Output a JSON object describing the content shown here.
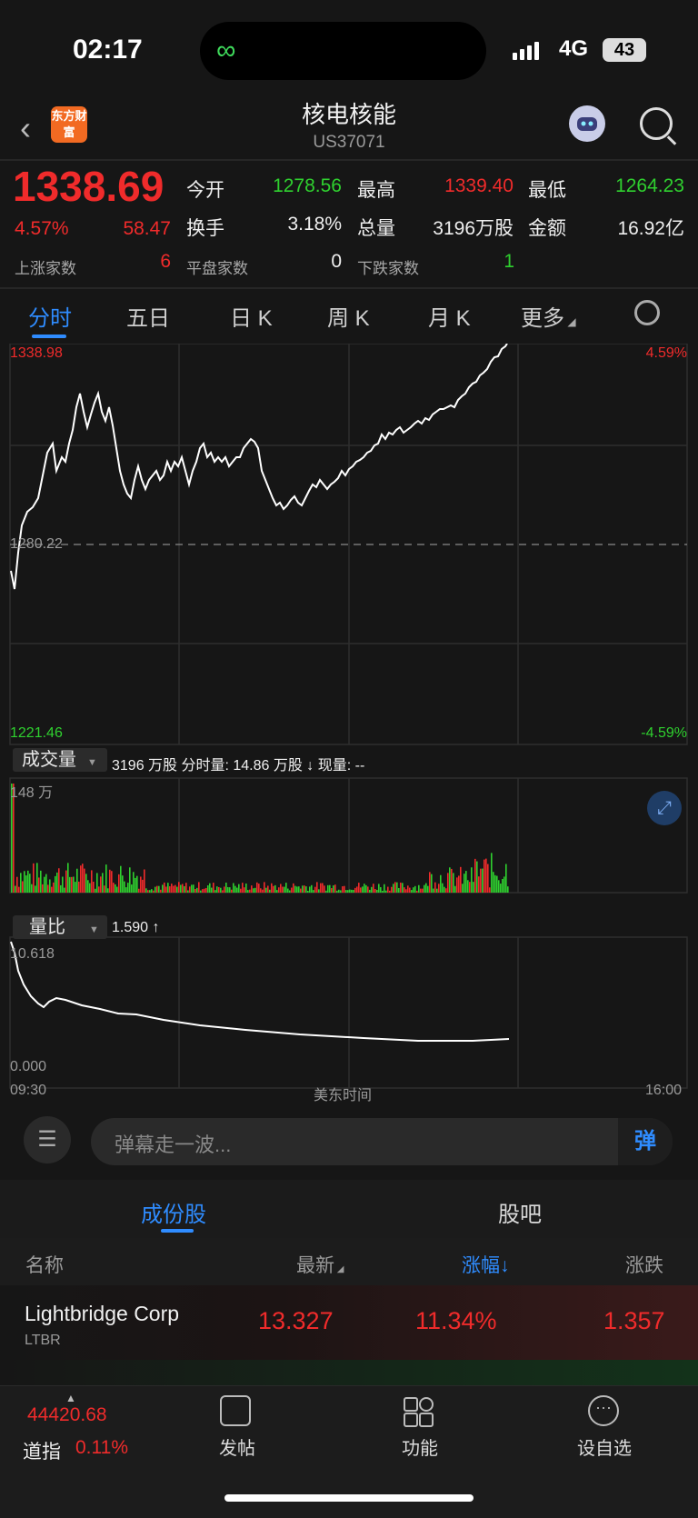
{
  "status_bar": {
    "time": "02:17",
    "network": "4G",
    "battery": "43"
  },
  "header": {
    "logo_text": "东方财富",
    "title": "核电核能",
    "code": "US37071"
  },
  "quote": {
    "price": "1338.69",
    "change_pct": "4.57%",
    "change": "58.47",
    "open_label": "今开",
    "open": "1278.56",
    "high_label": "最高",
    "high": "1339.40",
    "low_label": "最低",
    "low": "1264.23",
    "turnover_label": "换手",
    "turnover": "3.18%",
    "volume_label": "总量",
    "volume": "3196万股",
    "amount_label": "金额",
    "amount": "16.92亿",
    "up_label": "上涨家数",
    "up": "6",
    "flat_label": "平盘家数",
    "flat": "0",
    "down_label": "下跌家数",
    "down": "1"
  },
  "tabs": [
    "分时",
    "五日",
    "日 K",
    "周 K",
    "月 K",
    "更多"
  ],
  "chart": {
    "y_top": "1338.98",
    "pct_top": "4.59%",
    "y_mid": "1280.22",
    "y_bottom": "1221.46",
    "pct_bottom": "-4.59%",
    "vol_select": "成交量",
    "vol_info": "3196 万股  分时量: 14.86 万股 ↓  现量: --",
    "vol_max": "148 万",
    "ratio_select": "量比",
    "ratio_info": "1.590 ↑",
    "ratio_top": "10.618",
    "ratio_bottom": "0.000",
    "time_start": "09:30",
    "time_mid": "美东时间",
    "time_end": "16:00",
    "colors": {
      "up": "#f02b2b",
      "down": "#2fd02f",
      "line": "#ffffff"
    }
  },
  "comment": {
    "placeholder": "弹幕走一波...",
    "danmaku_button": "弹"
  },
  "lower_tabs": [
    "成份股",
    "股吧"
  ],
  "table": {
    "headers": [
      "名称",
      "最新",
      "涨幅↓",
      "涨跌"
    ],
    "rows": [
      {
        "name": "Lightbridge Corp",
        "code": "LTBR",
        "last": "13.327",
        "pct": "11.34%",
        "chg": "1.357"
      }
    ]
  },
  "bottom_bar": {
    "index_value": "44420.68",
    "index_name": "道指",
    "index_pct": "0.11%",
    "items": [
      "发帖",
      "功能",
      "设自选"
    ]
  }
}
